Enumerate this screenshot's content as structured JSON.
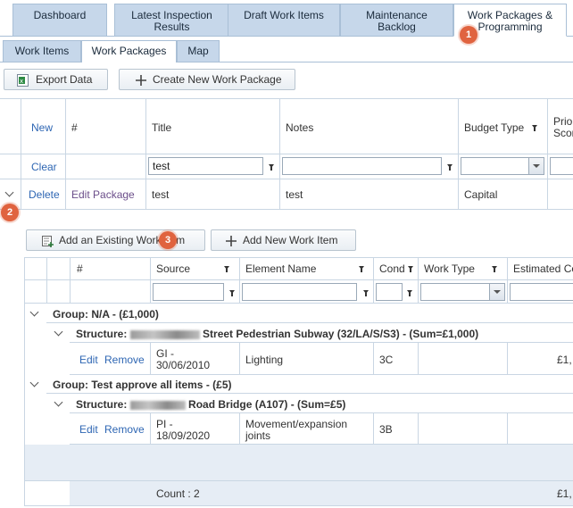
{
  "top_tabs": [
    {
      "label": "Dashboard"
    },
    {
      "label": "Latest Inspection Results"
    },
    {
      "label": "Draft Work Items"
    },
    {
      "label": "Maintenance Backlog"
    },
    {
      "label": "Work Packages & Programming"
    }
  ],
  "sub_tabs": [
    {
      "label": "Work Items"
    },
    {
      "label": "Work Packages"
    },
    {
      "label": "Map"
    }
  ],
  "toolbar": {
    "export_label": "Export Data",
    "create_label": "Create New Work Package"
  },
  "packages_grid": {
    "headers": {
      "new": "New",
      "num": "#",
      "title": "Title",
      "notes": "Notes",
      "budget_type": "Budget Type",
      "priority": "Priority Score"
    },
    "filter": {
      "clear": "Clear",
      "title_value": "test",
      "notes_value": ""
    },
    "row": {
      "delete": "Delete",
      "edit": "Edit Package",
      "title": "test",
      "notes": "test",
      "budget_type": "Capital"
    }
  },
  "detail_toolbar": {
    "add_existing_label": "Add an Existing Work Item",
    "add_new_label": "Add New Work Item"
  },
  "items_grid": {
    "headers": {
      "num": "#",
      "source": "Source",
      "element": "Element Name",
      "cond": "Cond",
      "work_type": "Work Type",
      "estimated_cost": "Estimated Cost"
    },
    "group1": {
      "label": "Group: N/A - (£1,000)",
      "structure_prefix": "Structure:",
      "structure_label": "Street Pedestrian Subway (32/LA/S/S3) - (Sum=£1,000)",
      "row": {
        "edit": "Edit",
        "remove": "Remove",
        "source": "GI -",
        "date": "30/06/2010",
        "element": "Lighting",
        "cond": "3C",
        "cost": "£1,"
      }
    },
    "group2": {
      "label": "Group: Test approve all items - (£5)",
      "structure_prefix": "Structure:",
      "structure_label": "Road Bridge (A107) - (Sum=£5)",
      "row": {
        "edit": "Edit",
        "remove": "Remove",
        "source": "PI -",
        "date": "18/09/2020",
        "element": "Movement/expansion",
        "element2": "joints",
        "cond": "3B",
        "cost": ""
      }
    },
    "footer": {
      "count": "Count : 2",
      "total": "£1,"
    }
  },
  "badges": [
    "1",
    "2",
    "3"
  ]
}
